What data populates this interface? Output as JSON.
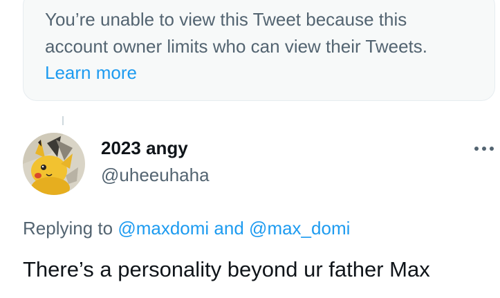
{
  "notice": {
    "line1": "You’re unable to view this Tweet because this",
    "line2": "account owner limits who can view their Tweets.",
    "link": "Learn more"
  },
  "reply": {
    "author": {
      "display_name": "2023 angy",
      "handle": "@uheeuhaha",
      "avatar_icon": "pikachu-avatar-icon"
    },
    "more_icon": "more-options-icon",
    "replying_to": {
      "prefix": "Replying to",
      "mention1": "@maxdomi",
      "conjunction": "and",
      "mention2": "@max_domi"
    },
    "text": "There’s a personality beyond ur father Max"
  },
  "colors": {
    "text_primary": "#0f1419",
    "text_secondary": "#536471",
    "link": "#1d9bf0",
    "notice_background": "#f7f9f9"
  }
}
